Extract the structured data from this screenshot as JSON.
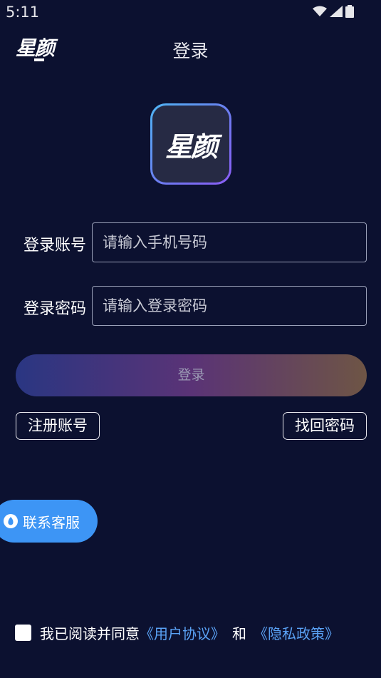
{
  "status_bar": {
    "time": "5:11",
    "icons": [
      "wifi-icon",
      "signal-icon",
      "battery-icon"
    ]
  },
  "header": {
    "brand": "星颜",
    "title": "登录"
  },
  "app_logo": {
    "text": "星颜"
  },
  "form": {
    "account": {
      "label": "登录账号",
      "placeholder": "请输入手机号码",
      "value": ""
    },
    "password": {
      "label": "登录密码",
      "placeholder": "请输入登录密码",
      "value": ""
    },
    "submit_label": "登录"
  },
  "links": {
    "register": "注册账号",
    "recover_password": "找回密码"
  },
  "support": {
    "label": "联系客服",
    "icon": "chat-bubble-icon"
  },
  "agreement": {
    "checked": false,
    "prefix": "我已阅读并同意",
    "user_agreement": "《用户协议》",
    "and": "和",
    "privacy_policy": "《隐私政策》"
  },
  "colors": {
    "background": "#0c1130",
    "accent_blue": "#3d95f5",
    "link": "#5aa2f5"
  }
}
